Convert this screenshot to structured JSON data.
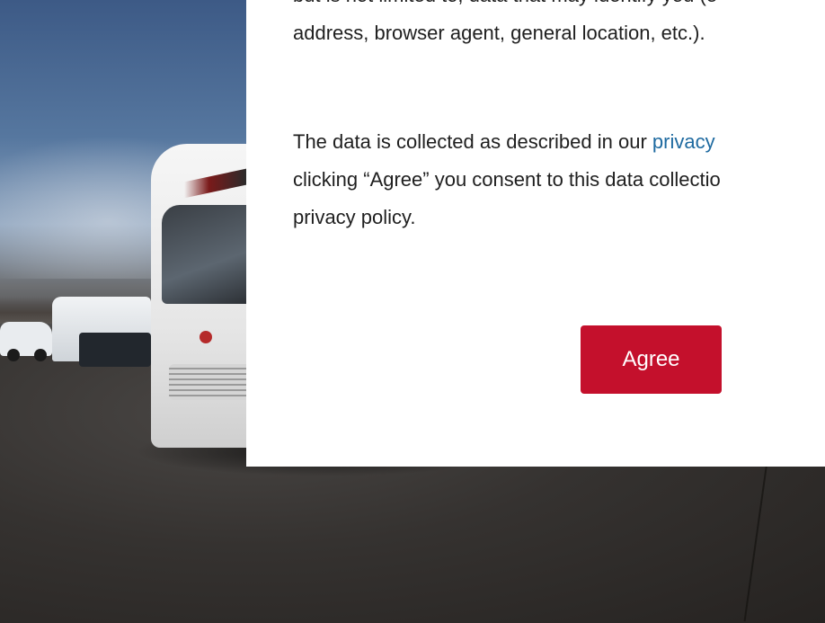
{
  "consent": {
    "paragraph1": {
      "line1": "but is not limited to, data that may identify you (e",
      "line2": "address, browser agent, general location, etc.)."
    },
    "paragraph2": {
      "line1_prefix": "The data is collected as described in our ",
      "line1_link": "privacy",
      "line2": "clicking “Agree” you consent to this data collectio",
      "line3": "privacy policy."
    },
    "agree_label": "Agree"
  },
  "colors": {
    "agree_button": "#c4102c",
    "link": "#1e6aa0",
    "modal_background": "#ffffff",
    "text": "#1f1f1f"
  }
}
